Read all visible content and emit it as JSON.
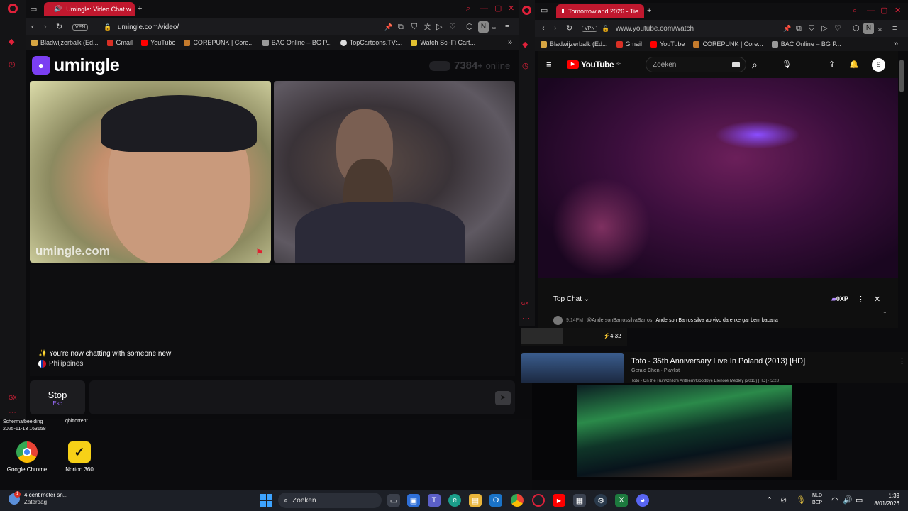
{
  "left_browser": {
    "tab_title": "Umingle: Video Chat w",
    "address": "umingle.com/video/",
    "vpn_label": "VPN",
    "bookmarks": [
      "Bladwijzerbalk (Ed...",
      "Gmail",
      "YouTube",
      "COREPUNK | Core...",
      "BAC Online – BG P...",
      "TopCartoons.TV:...",
      "Watch Sci-Fi Cart..."
    ],
    "profile_initial": "N"
  },
  "umingle": {
    "logo": "umingle",
    "online_count": "7384",
    "online_plus": "+",
    "online_label": "online",
    "watermark": "umingle.com",
    "status_message": "✨ You're now chatting with someone new",
    "country": "Philippines",
    "stop_label": "Stop",
    "stop_hint": "Esc"
  },
  "right_browser": {
    "tab_title": "Tomorrowland 2026 - Tie",
    "address": "www.youtube.com/watch",
    "vpn_label": "VPN",
    "bookmarks": [
      "Bladwijzerbalk (Ed...",
      "Gmail",
      "YouTube",
      "COREPUNK | Core...",
      "BAC Online – BG P..."
    ],
    "profile_initial": "N"
  },
  "youtube": {
    "logo": "YouTube",
    "region": "BE",
    "search_placeholder": "Zoeken",
    "avatar_initial": "S",
    "top_chat_label": "Top Chat",
    "xp_label": "0XP",
    "chat_time": "9:14PM",
    "chat_author": "@AndersonBarrossilvaBarros",
    "chat_text": "Anderson Barros silva ao vivo da enxergar bem bacana",
    "short_duration": "4:32",
    "rec_title": "Toto - 35th Anniversary Live In Poland (2013) [HD]",
    "rec_channel": "Gerald Chen · Playlist",
    "rec_sub": "Toto - On the Run/Child's Anthem/Goodbye Elenore Medley (2013) [HD] · 5:28"
  },
  "desktop": {
    "screenshot_label": "Schermafbeelding",
    "screenshot_date": "2025-11-13 163158",
    "qbit_label": "qbittorrent",
    "chrome_label": "Google Chrome",
    "norton_label": "Norton 360"
  },
  "taskbar": {
    "weather_temp": "4 centimeter sn...",
    "weather_day": "Zaterdag",
    "search_placeholder": "Zoeken",
    "lang1": "NLD",
    "lang2": "BEP",
    "time": "1:39",
    "date": "8/01/2026",
    "weather_badge": "1"
  }
}
